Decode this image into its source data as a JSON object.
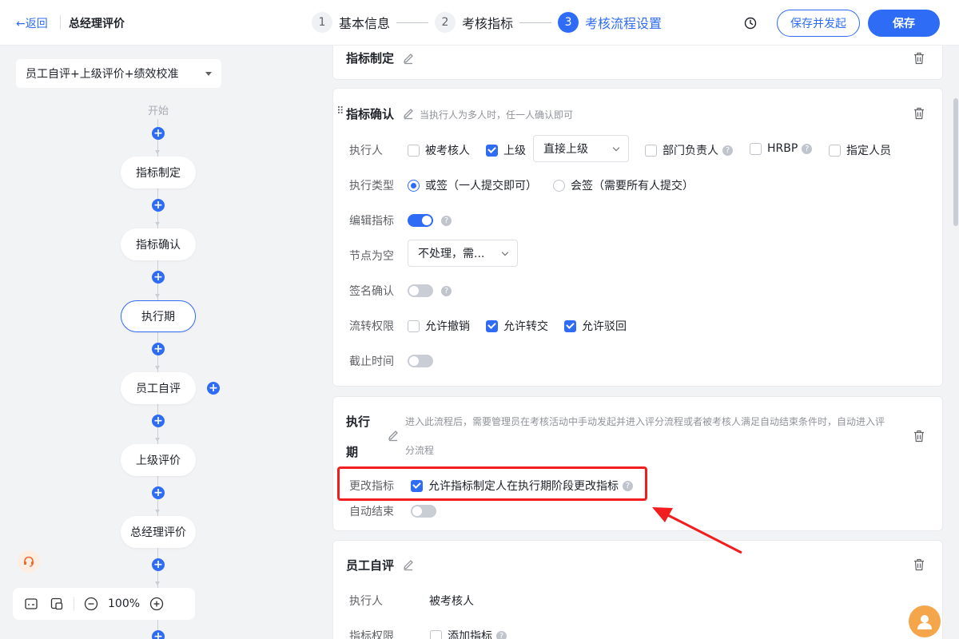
{
  "header": {
    "back_label": "←返回",
    "title": "总经理评价",
    "steps": [
      {
        "num": "1",
        "label": "基本信息"
      },
      {
        "num": "2",
        "label": "考核指标"
      },
      {
        "num": "3",
        "label": "考核流程设置"
      }
    ],
    "save_publish_label": "保存并发起",
    "save_label": "保存"
  },
  "left": {
    "template_value": "员工自评+上级评价+绩效校准",
    "start_label": "开始",
    "nodes": [
      "指标制定",
      "指标确认",
      "执行期",
      "员工自评",
      "上级评价",
      "总经理评价"
    ],
    "zoom": "100%"
  },
  "cards": {
    "zhibiao_zhiding": {
      "title": "指标制定"
    },
    "zhibiao_queren": {
      "title": "指标确认",
      "hint": "当执行人为多人时，任一人确认即可",
      "executor_label": "执行人",
      "executor_options": [
        "被考核人",
        "上级",
        "部门负责人",
        "HRBP",
        "指定人员"
      ],
      "superior_select": "直接上级",
      "type_label": "执行类型",
      "type_options": [
        "或签（一人提交即可）",
        "会签（需要所有人提交）"
      ],
      "edit_label": "编辑指标",
      "empty_label": "节点为空",
      "empty_select": "不处理，需...",
      "sign_label": "签名确认",
      "flow_label": "流转权限",
      "flow_options": [
        "允许撤销",
        "允许转交",
        "允许驳回"
      ],
      "deadline_label": "截止时间"
    },
    "zhixingqi": {
      "title_line1": "执行",
      "title_line2": "期",
      "hint_line1": "进入此流程后，需要管理员在考核活动中手动发起并进入评分流程或者被考核人满足自动结束条件时，自动进入评",
      "hint_line2": "分流程",
      "change_label": "更改指标",
      "change_option": "允许指标制定人在执行期阶段更改指标",
      "auto_end_label": "自动结束"
    },
    "yuangong_zipin": {
      "title": "员工自评",
      "executor_label": "执行人",
      "executor_value": "被考核人",
      "perm_label": "指标权限",
      "perm_option": "添加指标"
    }
  },
  "colors": {
    "accent": "#2f6cf6",
    "highlight": "#f01e1e"
  }
}
